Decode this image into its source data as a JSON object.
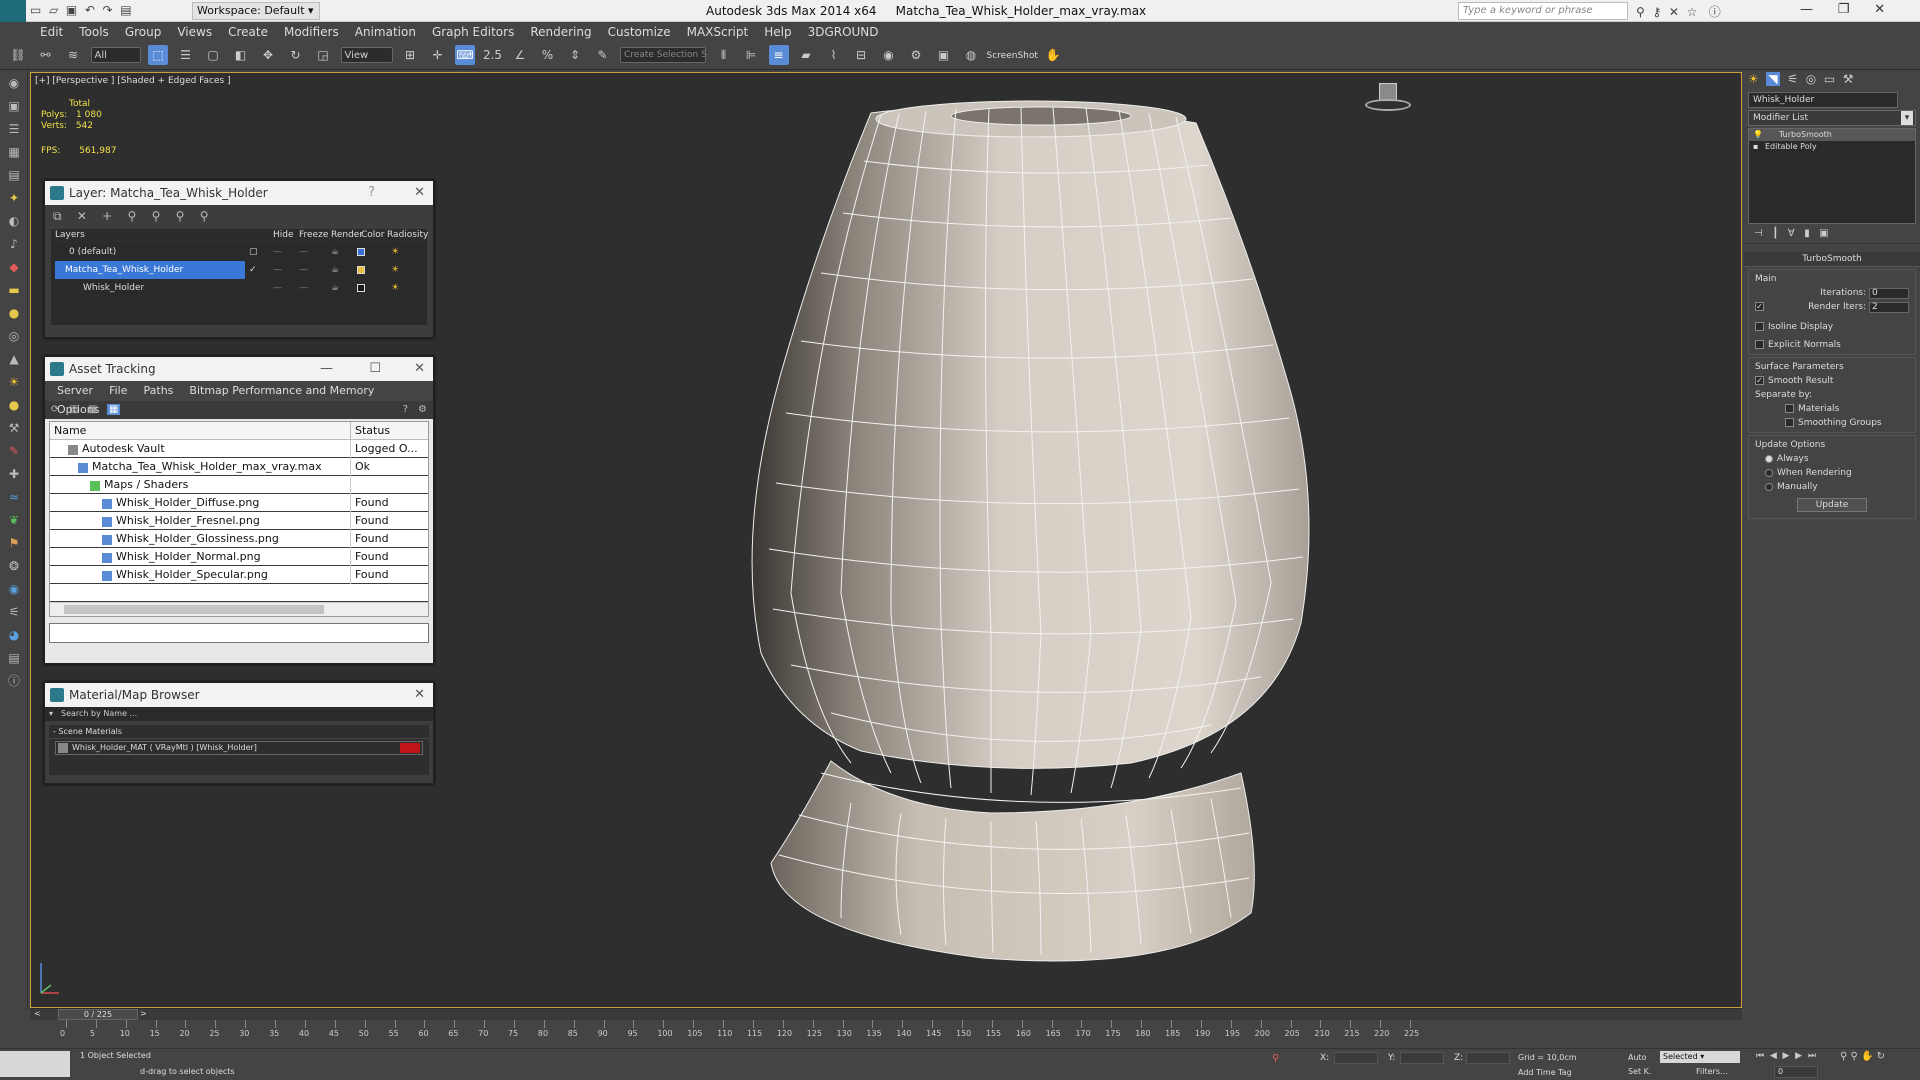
{
  "titlebar": {
    "workspace": "Workspace: Default",
    "app": "Autodesk 3ds Max  2014 x64",
    "file": "Matcha_Tea_Whisk_Holder_max_vray.max",
    "search_placeholder": "Type a keyword or phrase"
  },
  "menu": [
    "Edit",
    "Tools",
    "Group",
    "Views",
    "Create",
    "Modifiers",
    "Animation",
    "Graph Editors",
    "Rendering",
    "Customize",
    "MAXScript",
    "Help",
    "3DGROUND"
  ],
  "toolbar": {
    "filter": "All",
    "refcoord": "View",
    "selection_set": "Create Selection S",
    "screenshot": "ScreenShot"
  },
  "viewport": {
    "label": "[+] [Perspective ] [Shaded + Edged Faces ]",
    "stats_header": "Total",
    "polys_label": "Polys:",
    "polys": "1 080",
    "verts_label": "Verts:",
    "verts": "542",
    "fps_label": "FPS:",
    "fps": "561,987"
  },
  "layer_dialog": {
    "title": "Layer: Matcha_Tea_Whisk_Holder",
    "help": "?",
    "columns": [
      "Layers",
      "Hide",
      "Freeze",
      "Render",
      "Color",
      "Radiosity"
    ],
    "rows": [
      {
        "name": "0 (default)",
        "color": "#3a6fd8"
      },
      {
        "name": "Matcha_Tea_Whisk_Holder",
        "color": "#e8c040"
      },
      {
        "name": "Whisk_Holder",
        "color": "#1a1a1a"
      }
    ]
  },
  "asset_tracking": {
    "title": "Asset Tracking",
    "menu": [
      "Server",
      "File",
      "Paths",
      "Bitmap Performance and Memory",
      "Options"
    ],
    "columns": [
      "Name",
      "Status"
    ],
    "rows": [
      {
        "name": "Autodesk Vault",
        "status": "Logged O..."
      },
      {
        "name": "Matcha_Tea_Whisk_Holder_max_vray.max",
        "status": "Ok"
      },
      {
        "name": "Maps / Shaders",
        "status": ""
      },
      {
        "name": "Whisk_Holder_Diffuse.png",
        "status": "Found"
      },
      {
        "name": "Whisk_Holder_Fresnel.png",
        "status": "Found"
      },
      {
        "name": "Whisk_Holder_Glossiness.png",
        "status": "Found"
      },
      {
        "name": "Whisk_Holder_Normal.png",
        "status": "Found"
      },
      {
        "name": "Whisk_Holder_Specular.png",
        "status": "Found"
      }
    ]
  },
  "material_browser": {
    "title": "Material/Map Browser",
    "search_placeholder": "Search by Name ...",
    "section": "- Scene Materials",
    "item": "Whisk_Holder_MAT  ( VRayMtl )  [Whisk_Holder]",
    "swatch_color": "#c0141a"
  },
  "command_panel": {
    "object_name": "Whisk_Holder",
    "modifier_list": "Modifier List",
    "stack": [
      "TurboSmooth",
      "Editable Poly"
    ],
    "rollout_title": "TurboSmooth",
    "main_label": "Main",
    "iterations_label": "Iterations:",
    "iterations": "0",
    "render_iters_label": "Render Iters:",
    "render_iters": "2",
    "isoline": "Isoline Display",
    "explicit": "Explicit Normals",
    "surface_label": "Surface Parameters",
    "smooth_result": "Smooth Result",
    "separate_by": "Separate by:",
    "materials": "Materials",
    "smoothing_groups": "Smoothing Groups",
    "update_label": "Update Options",
    "always": "Always",
    "when_rendering": "When Rendering",
    "manually": "Manually",
    "update_btn": "Update"
  },
  "timeline": {
    "frame": "0 / 225",
    "ticks": [
      "0",
      "5",
      "10",
      "15",
      "20",
      "25",
      "30",
      "35",
      "40",
      "45",
      "50",
      "55",
      "60",
      "65",
      "70",
      "75",
      "80",
      "85",
      "90",
      "95",
      "100",
      "105",
      "110",
      "115",
      "120",
      "125",
      "130",
      "135",
      "140",
      "145",
      "150",
      "155",
      "160",
      "165",
      "170",
      "175",
      "180",
      "185",
      "190",
      "195",
      "200",
      "205",
      "210",
      "215",
      "220",
      "225"
    ]
  },
  "status": {
    "selected": "1 Object Selected",
    "prompt": "d-drag to select objects",
    "x_label": "X:",
    "y_label": "Y:",
    "z_label": "Z:",
    "grid": "Grid = 10,0cm",
    "auto": "Auto",
    "selected_dd": "Selected",
    "set_k": "Set K.",
    "filters": "Filters...",
    "add_time_tag": "Add Time Tag",
    "frame_value": "0"
  }
}
